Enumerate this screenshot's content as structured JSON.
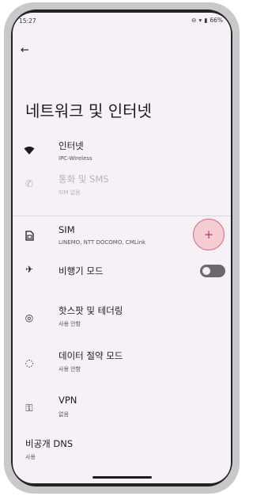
{
  "status": {
    "time": "15:27",
    "battery": "66%"
  },
  "header": {
    "back_icon": "arrow-left-icon",
    "title": "네트워크 및 인터넷"
  },
  "items": [
    {
      "name": "internet",
      "icon": "wifi-icon",
      "label": "인터넷",
      "sub": "IPC-Wireless",
      "enabled": true
    },
    {
      "name": "calls-sms",
      "icon": "calls-sms-icon",
      "label": "통화 및 SMS",
      "sub": "SIM 없음",
      "enabled": false
    },
    {
      "name": "sim",
      "icon": "sim-card-icon",
      "label": "SIM",
      "sub": "LINEMO, NTT DOCOMO, CMLink",
      "enabled": true
    },
    {
      "name": "airplane-mode",
      "icon": "airplane-icon",
      "label": "비행기 모드",
      "sub": "",
      "enabled": true,
      "toggle": false
    },
    {
      "name": "hotspot",
      "icon": "hotspot-icon",
      "label": "핫스팟 및 테더링",
      "sub": "사용 안함",
      "enabled": true
    },
    {
      "name": "data-saver",
      "icon": "data-saver-icon",
      "label": "데이터 절약 모드",
      "sub": "사용 안함",
      "enabled": true
    },
    {
      "name": "vpn",
      "icon": "vpn-key-icon",
      "label": "VPN",
      "sub": "없음",
      "enabled": true
    },
    {
      "name": "private-dns",
      "icon": "",
      "label": "비공개 DNS",
      "sub": "사용",
      "enabled": true
    }
  ],
  "sim_add_button": {
    "label": "+"
  }
}
